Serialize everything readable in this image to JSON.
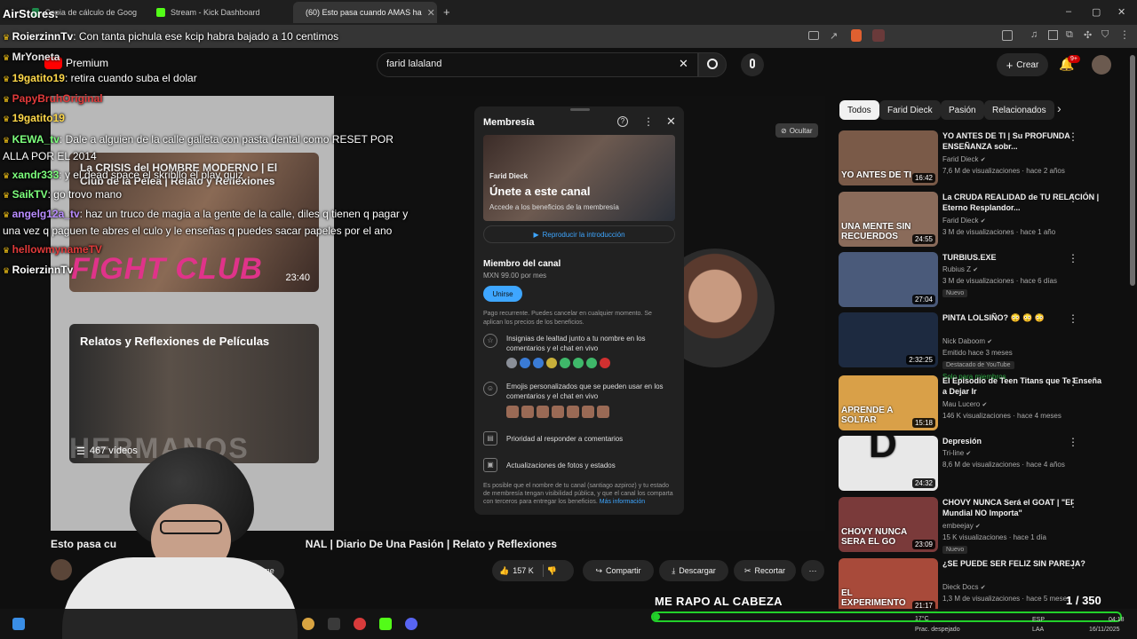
{
  "browser": {
    "tabs": [
      {
        "label": "Copia de cálculo de Goog"
      },
      {
        "label": "Stream - Kick Dashboard"
      },
      {
        "label": "(60) Esto pasa cuando AMAS ha"
      }
    ]
  },
  "youtube": {
    "brand": "Premium",
    "search_value": "farid lalaland",
    "create_label": "Crear",
    "notifications_badge": "9+"
  },
  "player": {
    "endscreen_cards": [
      {
        "title": "La CRISIS del HOMBRE MODERNO | El Club de la Pelea | Relato y Reflexiones",
        "brand_text": "FIGHT CLUB",
        "duration": "23:40"
      },
      {
        "title": "Relatos y Reflexiones de Películas",
        "overlay_text": "HERMANOS",
        "count_label": "467 vídeos"
      }
    ],
    "hide_label": "Ocultar"
  },
  "membership": {
    "title": "Membresía",
    "channel_name": "Farid Dieck",
    "hero_title": "Únete a este canal",
    "hero_subtitle": "Accede a los beneficios de la membresía",
    "play_intro": "Reproducir la introducción",
    "tier_name": "Miembro del canal",
    "price": "MXN 99.00 por mes",
    "join_label": "Unirse",
    "recurring_note": "Pago recurrente. Puedes cancelar en cualquier momento. Se aplican los precios de los beneficios.",
    "benefits": [
      {
        "text": "Insignias de lealtad junto a tu nombre en los comentarios y el chat en vivo"
      },
      {
        "text": "Emojis personalizados que se pueden usar en los comentarios y el chat en vivo"
      },
      {
        "text": "Prioridad al responder a comentarios"
      },
      {
        "text": "Actualizaciones de fotos y estados"
      }
    ],
    "footer": "Es posible que el nombre de tu canal (santiago azpiroz) y tu estado de membresía tengan visibilidad pública, y que el canal los comparta con terceros para entregar los beneficios.",
    "footer_link": "Más información",
    "badge_colors": [
      "#8a8f98",
      "#3a7bd5",
      "#3a7bd5",
      "#c9b03a",
      "#3fb86a",
      "#3fb86a",
      "#3fb86a",
      "#d03030"
    ]
  },
  "sidebar": {
    "chips": [
      {
        "label": "Todos"
      },
      {
        "label": "Farid Dieck"
      },
      {
        "label": "Pasión"
      },
      {
        "label": "Relacionados"
      }
    ],
    "recommendations": [
      {
        "title": "YO ANTES DE TI | Su PROFUNDA ENSEÑANZA sobr...",
        "channel": "Farid Dieck",
        "meta": "7,6 M de visualizaciones · hace 2 años",
        "duration": "16:42",
        "thumb_text": "YO ANTES DE TI"
      },
      {
        "title": "La CRUDA REALIDAD de TU RELACIÓN | Eterno Resplandor...",
        "channel": "Farid Dieck",
        "meta": "3 M de visualizaciones · hace 1 año",
        "duration": "24:55",
        "thumb_text": "UNA MENTE SIN RECUERDOS"
      },
      {
        "title": "TURBIUS.EXE",
        "channel": "Rubius Z",
        "meta": "3 M de visualizaciones · hace 6 días",
        "duration": "27:04",
        "tag": "Nuevo"
      },
      {
        "title": "PINTA LOLSIÑO? 😳 😳 😳",
        "channel": "Nick Daboom",
        "meta": "Emitido hace 3 meses",
        "duration": "2:32:25",
        "extra1": "Destacado de YouTube",
        "extra2": "Solo para miembros"
      },
      {
        "title": "El Episodio de Teen Titans que Te Enseña a Dejar Ir",
        "channel": "Mau Lucero",
        "meta": "146 K visualizaciones · hace 4 meses",
        "duration": "15:18",
        "thumb_text": "APRENDE A SOLTAR"
      },
      {
        "title": "Depresión",
        "channel": "Tri-line",
        "meta": "8,6 M de visualizaciones · hace 4 años",
        "duration": "24:32",
        "thumb_text": "D"
      },
      {
        "title": "CHOVY NUNCA Será el GOAT | \"El Mundial NO Importa\"",
        "channel": "embeejay",
        "meta": "15 K visualizaciones · hace 1 día",
        "duration": "23:09",
        "tag": "Nuevo",
        "thumb_text": "CHOVY NUNCA SERA EL GO"
      },
      {
        "title": "¿SE PUEDE SER FELIZ SIN PAREJA?",
        "channel": "Dieck Docs",
        "meta": "1,3 M de visualizaciones · hace 5 meses",
        "duration": "21:17",
        "thumb_text": "EL EXPERIMENTO"
      }
    ]
  },
  "video": {
    "title_visible": "Esto pasa cu",
    "title_rest": "NAL | Diario De Una Pasión | Relato y Reflexiones",
    "subscribe_label": "ribirme",
    "likes": "157 K",
    "share_label": "Compartir",
    "download_label": "Descargar",
    "clip_label": "Recortar"
  },
  "chat": [
    {
      "user": "RoierzinnTv",
      "msg": "Con tanta pichula ese kcip habra bajado a 10 centimos",
      "color": "#ffffff"
    },
    {
      "user": "MrYoneta",
      "msg": "",
      "color": "#e8e8e8"
    },
    {
      "user": "19gatito19",
      "msg": "retira cuando suba el dolar",
      "color": "#ffd94a"
    },
    {
      "user": "PapyBruhOriginal",
      "msg": "",
      "color": "#e23b3b"
    },
    {
      "user": "19gatito19",
      "msg": "",
      "color": "#ffd94a"
    },
    {
      "user": "KEWA_tv",
      "msg": "Dale a alguien de la calle galleta con pasta dental como RESET POR",
      "color": "#7dff7d"
    },
    {
      "user": "",
      "msg": "ALLA POR EL 2014",
      "color": "#ffffff"
    },
    {
      "user": "xandr333",
      "msg": "y el dead space el skribllo el play quiz",
      "color": "#7dff7d"
    },
    {
      "user": "SaikTV",
      "msg": "go trovo mano",
      "color": "#7dff7d"
    },
    {
      "user": "angelg12a_tv",
      "msg": "haz un truco de magia a la gente de la calle, diles q tienen q pagar y",
      "color": "#b98cff"
    },
    {
      "user": "",
      "msg": "una vez q paguen te abres el culo y le enseñas q puedes sacar papeles por el ano",
      "color": "#ffffff"
    },
    {
      "user": "hellowmynameTV",
      "msg": "",
      "color": "#e23b3b"
    },
    {
      "user": "RoierzinnTv",
      "msg": "",
      "color": "#ffffff"
    }
  ],
  "overlay": {
    "airstores": "AirStores:",
    "goal_text": "ME RAPO AL CABEZA",
    "goal_counter": "1 / 350",
    "goal_progress": 0.003
  },
  "taskbar": {
    "weather": "17°C",
    "weather_desc": "Prac. despejado",
    "lang": "ESP",
    "lang2": "LAA",
    "time": "04:18",
    "date": "16/11/2025"
  }
}
